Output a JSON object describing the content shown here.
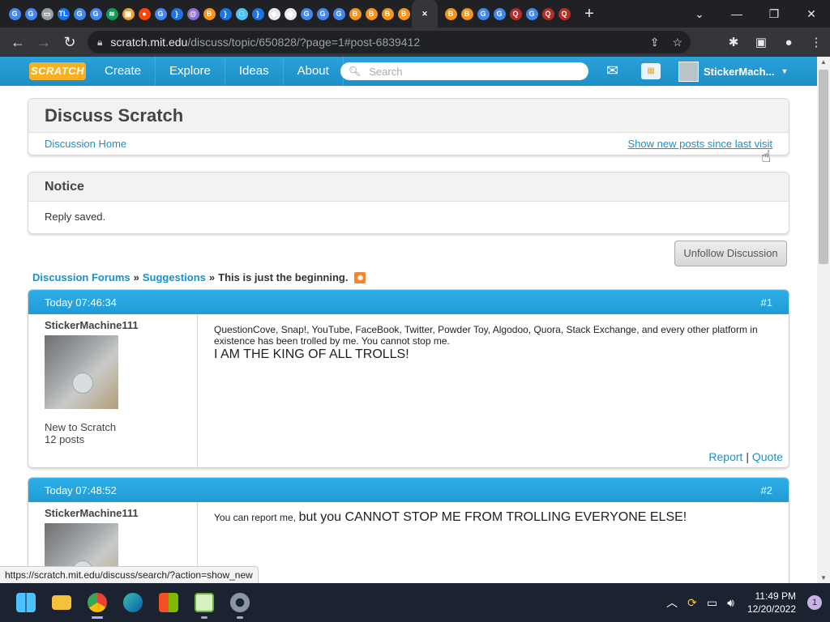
{
  "browser": {
    "tab_icons": [
      {
        "name": "google-icon",
        "color": "#4285f4",
        "glyph": "G"
      },
      {
        "name": "google-icon",
        "color": "#4285f4",
        "glyph": "G"
      },
      {
        "name": "monitor-icon",
        "color": "#9aa0a6",
        "glyph": "▭"
      },
      {
        "name": "tl-icon",
        "color": "#1a73e8",
        "glyph": "TL"
      },
      {
        "name": "google-icon",
        "color": "#4285f4",
        "glyph": "G"
      },
      {
        "name": "google-icon",
        "color": "#4285f4",
        "glyph": "G"
      },
      {
        "name": "wifi-icon",
        "color": "#0f9d58",
        "glyph": "≋"
      },
      {
        "name": "orange-app-icon",
        "color": "#f4a223",
        "glyph": "▦"
      },
      {
        "name": "reddit-icon",
        "color": "#ff4500",
        "glyph": "●"
      },
      {
        "name": "google-icon",
        "color": "#4285f4",
        "glyph": "G"
      },
      {
        "name": "brace-icon",
        "color": "#1a73e8",
        "glyph": "}"
      },
      {
        "name": "at-icon",
        "color": "#8e6bd8",
        "glyph": "@"
      },
      {
        "name": "bitcoin-icon",
        "color": "#f7931a",
        "glyph": "B"
      },
      {
        "name": "brace-icon",
        "color": "#1a73e8",
        "glyph": "}"
      },
      {
        "name": "chat-icon",
        "color": "#4fc3f7",
        "glyph": "□"
      },
      {
        "name": "brace-icon",
        "color": "#1a73e8",
        "glyph": "}"
      },
      {
        "name": "roblox-icon",
        "color": "#e8eaed",
        "glyph": "◆"
      },
      {
        "name": "github-icon",
        "color": "#e8eaed",
        "glyph": "◉"
      },
      {
        "name": "google-icon",
        "color": "#4285f4",
        "glyph": "G"
      },
      {
        "name": "google-icon",
        "color": "#4285f4",
        "glyph": "G"
      },
      {
        "name": "google-icon",
        "color": "#4285f4",
        "glyph": "G"
      },
      {
        "name": "bitcoin-icon",
        "color": "#f7931a",
        "glyph": "B"
      },
      {
        "name": "bitcoin-icon",
        "color": "#f7931a",
        "glyph": "B"
      },
      {
        "name": "bitcoin-icon",
        "color": "#f7931a",
        "glyph": "B"
      },
      {
        "name": "bitcoin-icon",
        "color": "#f7931a",
        "glyph": "B"
      }
    ],
    "tab_icons_after": [
      {
        "name": "bitcoin-icon",
        "color": "#f7931a",
        "glyph": "B"
      },
      {
        "name": "bitcoin-icon",
        "color": "#f7931a",
        "glyph": "B"
      },
      {
        "name": "google-icon",
        "color": "#4285f4",
        "glyph": "G"
      },
      {
        "name": "google-icon",
        "color": "#4285f4",
        "glyph": "G"
      },
      {
        "name": "quora-icon",
        "color": "#b92b27",
        "glyph": "Q"
      },
      {
        "name": "google-icon",
        "color": "#4285f4",
        "glyph": "G"
      },
      {
        "name": "quora-icon",
        "color": "#b92b27",
        "glyph": "Q"
      },
      {
        "name": "quora-icon",
        "color": "#b92b27",
        "glyph": "Q"
      }
    ],
    "url_host": "scratch.mit.edu",
    "url_path": "/discuss/topic/650828/?page=1#post-6839412",
    "status_url": "https://scratch.mit.edu/discuss/search/?action=show_new"
  },
  "scratch_nav": {
    "logo": "SCRATCH",
    "links": [
      "Create",
      "Explore",
      "Ideas",
      "About"
    ],
    "search_placeholder": "Search",
    "username": "StickerMach..."
  },
  "discuss": {
    "title": "Discuss Scratch",
    "home_link": "Discussion Home",
    "new_posts_link": "Show new posts since last visit"
  },
  "notice": {
    "title": "Notice",
    "message": "Reply saved."
  },
  "unfollow_label": "Unfollow Discussion",
  "breadcrumb": {
    "forums": "Discussion Forums",
    "sep1": "»",
    "category": "Suggestions",
    "sep2": "»",
    "topic": "This is just the beginning."
  },
  "posts": [
    {
      "time": "Today 07:46:34",
      "number": "#1",
      "username": "StickerMachine111",
      "rank": "New to Scratch",
      "count": "12 posts",
      "text_small": "QuestionCove, Snap!, YouTube, FaceBook, Twitter, Powder Toy, Algodoo, Quora, Stack Exchange, and every other platform in existence has been trolled by me. You cannot stop me.",
      "text_big": "I AM THE KING OF ALL TROLLS!",
      "report": "Report",
      "sep": "|",
      "quote": "Quote"
    },
    {
      "time": "Today 07:48:52",
      "number": "#2",
      "username": "StickerMachine111",
      "text_small": "You can report me,",
      "text_big": "but you CANNOT STOP ME FROM TROLLING EVERYONE ELSE!"
    }
  ],
  "taskbar": {
    "time": "11:49 PM",
    "date": "12/20/2022",
    "notifications": "1"
  }
}
